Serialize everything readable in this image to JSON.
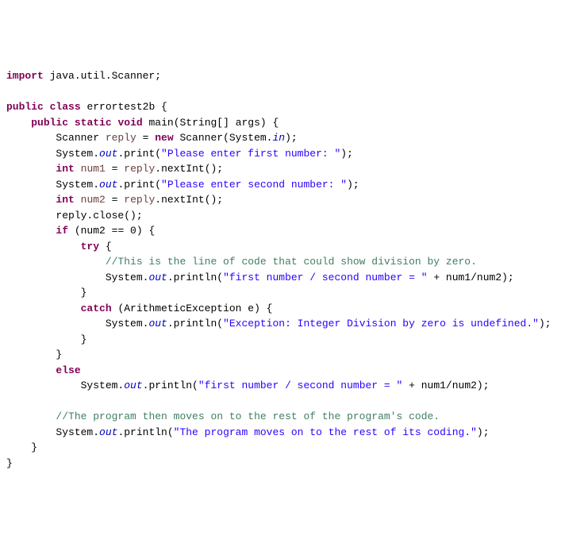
{
  "code": {
    "kw_import": "import",
    "import_pkg": " java.util.Scanner;",
    "kw_public": "public",
    "kw_class": "class",
    "class_name": " errortest2b {",
    "kw_static": "static",
    "kw_void": "void",
    "method_sig": " main(String[] args) {",
    "scanner_type": "        Scanner ",
    "var_reply": "reply",
    "eq_new": " = ",
    "kw_new": "new",
    "scanner_ctor": " Scanner(System.",
    "field_in": "in",
    "close_paren": ");",
    "sys_out_prefix": "        System.",
    "sys_out_prefix2": "            System.",
    "sys_out_prefix3": "                System.",
    "field_out": "out",
    "print_call": ".print(",
    "println_call": ".println(",
    "str_first_prompt": "\"Please enter first number: \"",
    "str_second_prompt": "\"Please enter second number: \"",
    "kw_int": "int",
    "var_num1": "num1",
    "var_num2": "num2",
    "assign_reply": " = ",
    "nextint": ".nextInt();",
    "reply_close": "        reply.close();",
    "indent2": "        ",
    "indent3": "            ",
    "indent4": "                ",
    "kw_if": "if",
    "if_cond": " (num2 == 0) {",
    "kw_try": "try",
    "try_open": " {",
    "comment_div": "//This is the line of code that could show division by zero.",
    "str_division": "\"first number / second number = \"",
    "plus_expr": " + num1/num2);",
    "close_brace3": "            }",
    "close_brace2": "        }",
    "kw_catch": "catch",
    "catch_sig": " (ArithmeticException e) {",
    "str_exception": "\"Exception: Integer Division by zero is undefined.\"",
    "close_str": ");",
    "kw_else": "else",
    "comment_rest": "//The program then moves on to the rest of the program's code.",
    "str_rest": "\"The program moves on to the rest of its coding.\"",
    "close_brace1": "    }",
    "close_brace0": "}"
  }
}
